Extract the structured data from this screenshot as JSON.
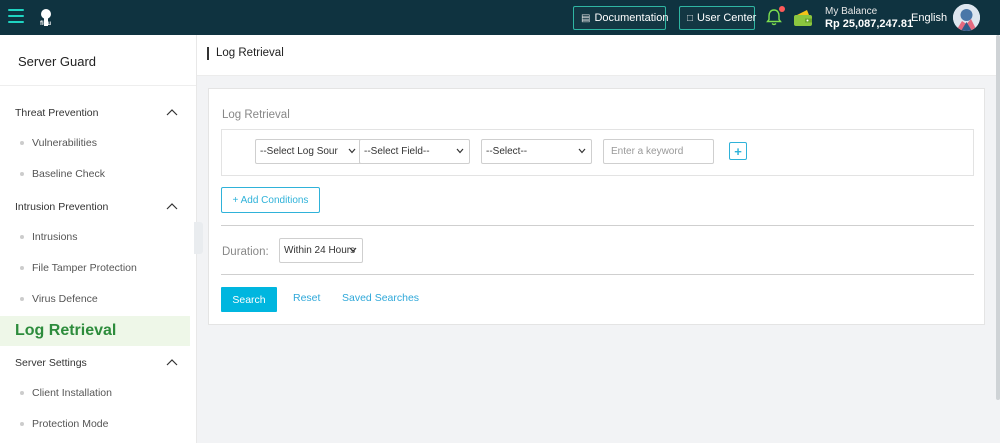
{
  "topbar": {
    "documentation_label": "Documentation",
    "user_center_label": "User Center",
    "balance_label": "My Balance",
    "balance_value": "Rp 25,087,247.81",
    "language": "English",
    "logo_text": "flou"
  },
  "sidebar": {
    "title": "Server Guard",
    "rows": [
      {
        "type": "group",
        "label": "Threat Prevention",
        "expanded": true
      },
      {
        "type": "item",
        "label": "Vulnerabilities"
      },
      {
        "type": "item",
        "label": "Baseline Check"
      },
      {
        "type": "group",
        "label": "Intrusion Prevention",
        "expanded": true
      },
      {
        "type": "item",
        "label": "Intrusions"
      },
      {
        "type": "item",
        "label": "File Tamper Protection"
      },
      {
        "type": "item",
        "label": "Virus Defence"
      },
      {
        "type": "active",
        "label": "Log Retrieval"
      },
      {
        "type": "group",
        "label": "Server Settings",
        "expanded": true
      },
      {
        "type": "item",
        "label": "Client Installation"
      },
      {
        "type": "item",
        "label": "Protection Mode"
      }
    ]
  },
  "page": {
    "title": "Log Retrieval"
  },
  "panel": {
    "title": "Log Retrieval",
    "log_source_select": "--Select Log Sour",
    "field_select": "--Select Field--",
    "operator_select": "--Select--",
    "keyword_placeholder": "Enter a keyword",
    "add_symbol": "+",
    "add_conditions_label": "+ Add Conditions",
    "duration_label": "Duration:",
    "duration_value": "Within 24 Hours",
    "search_label": "Search",
    "reset_label": "Reset",
    "saved_searches_label": "Saved Searches"
  },
  "colors": {
    "topbar": "#0f3340",
    "accent": "#00b6df",
    "active_menu_bg": "#eef7e8",
    "active_menu_text": "#2d8c3c"
  }
}
